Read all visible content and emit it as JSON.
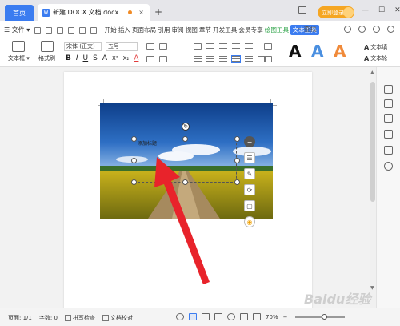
{
  "titlebar": {
    "home_tab": "首页",
    "doc_tab": "新建 DOCX 文档.docx",
    "doc_icon_letter": "W",
    "add_tab": "+",
    "login_button": "立即登录",
    "window_controls": [
      "—",
      "☐",
      "✕"
    ]
  },
  "menubar": {
    "file_menu": "☰ 文件 ▾",
    "menu_items": [
      "开始",
      "插入",
      "页面布局",
      "引用",
      "审阅",
      "视图",
      "章节",
      "开发工具",
      "会员专享",
      "绘图工具",
      "文本工具"
    ],
    "active_green": "绘图工具",
    "active_blue": "文本工具",
    "search_label": "查找"
  },
  "ribbon": {
    "text_box_label": "文本框 ▾",
    "format_painter_label": "格式刷",
    "font_name": "宋体 (正文)",
    "font_size": "五号",
    "format_buttons": [
      "B",
      "I",
      "U",
      "S",
      "A",
      "X²",
      "X₂",
      "A"
    ],
    "style_letters": [
      "A",
      "A",
      "A"
    ],
    "style_colors": [
      "#111111",
      "#4a8fe0",
      "#f08a3a"
    ],
    "text_fill_label": "文本填",
    "text_outline_label": "文本轮"
  },
  "document": {
    "selected_text": "添加标题"
  },
  "floating_tools": {
    "icons": [
      "collapse-icon",
      "layout-icon",
      "pen-icon",
      "crop-icon",
      "frame-icon",
      "bulb-icon"
    ]
  },
  "statusbar": {
    "page_info": "页面: 1/1",
    "word_count": "字数: 0",
    "spell_check": "拼写检查",
    "doc_proof": "文档校对",
    "zoom": "70%",
    "zoom_fraction": 0.6
  },
  "watermark": "Baidu经验"
}
